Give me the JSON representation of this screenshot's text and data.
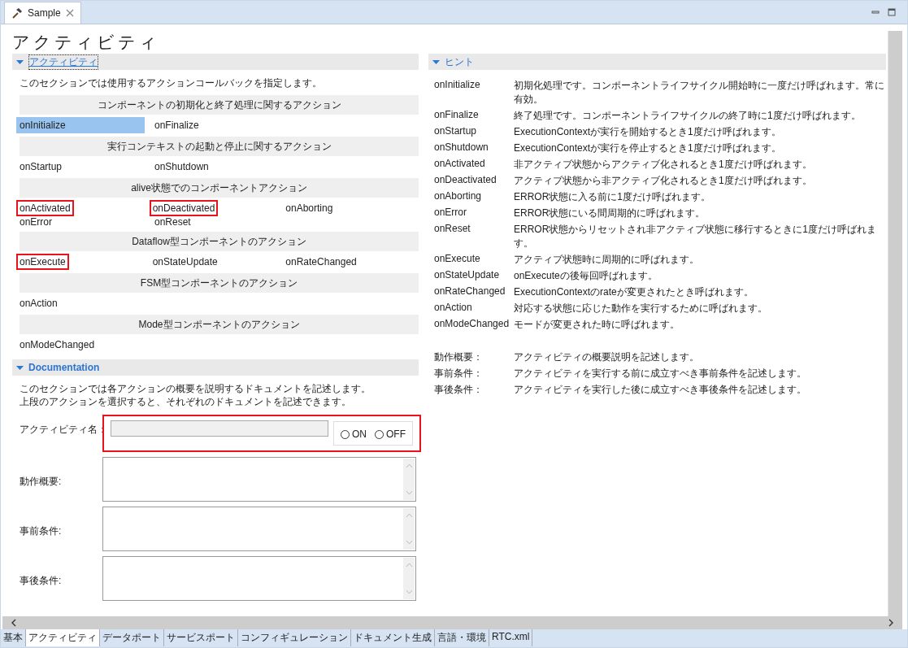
{
  "editor_tab": {
    "title": "Sample",
    "selected": true
  },
  "page_title": "アクティビティ",
  "activity_section": {
    "title": "アクティビティ",
    "expanded": true,
    "description": "このセクションでは使用するアクションコールバックを指定します。",
    "groups": [
      {
        "header": "コンポーネントの初期化と終了処理に関するアクション",
        "rows": [
          [
            {
              "name": "onInitialize",
              "selected": true,
              "highlighted": false
            },
            {
              "name": "onFinalize",
              "selected": false,
              "highlighted": false
            }
          ]
        ]
      },
      {
        "header": "実行コンテキストの起動と停止に関するアクション",
        "rows": [
          [
            {
              "name": "onStartup",
              "selected": false,
              "highlighted": false
            },
            {
              "name": "onShutdown",
              "selected": false,
              "highlighted": false
            }
          ]
        ]
      },
      {
        "header": "alive状態でのコンポーネントアクション",
        "rows": [
          [
            {
              "name": "onActivated",
              "selected": false,
              "highlighted": true
            },
            {
              "name": "onDeactivated",
              "selected": false,
              "highlighted": true
            },
            {
              "name": "onAborting",
              "selected": false,
              "highlighted": false
            }
          ],
          [
            {
              "name": "onError",
              "selected": false,
              "highlighted": false
            },
            {
              "name": "onReset",
              "selected": false,
              "highlighted": false
            }
          ]
        ]
      },
      {
        "header": "Dataflow型コンポーネントのアクション",
        "rows": [
          [
            {
              "name": "onExecute",
              "selected": false,
              "highlighted": true
            },
            {
              "name": "onStateUpdate",
              "selected": false,
              "highlighted": false
            },
            {
              "name": "onRateChanged",
              "selected": false,
              "highlighted": false
            }
          ]
        ]
      },
      {
        "header": "FSM型コンポーネントのアクション",
        "rows": [
          [
            {
              "name": "onAction",
              "selected": false,
              "highlighted": false
            }
          ]
        ]
      },
      {
        "header": "Mode型コンポーネントのアクション",
        "rows": [
          [
            {
              "name": "onModeChanged",
              "selected": false,
              "highlighted": false
            }
          ]
        ]
      }
    ]
  },
  "documentation_section": {
    "title": "Documentation",
    "expanded": true,
    "description_lines": [
      "このセクションでは各アクションの概要を説明するドキュメントを記述します。",
      "上段のアクションを選択すると、それぞれのドキュメントを記述できます。"
    ],
    "name_field": {
      "label": "アクティビティ名：",
      "disabled": true,
      "highlighted": true
    },
    "radios": [
      {
        "label": "ON",
        "selected": false
      },
      {
        "label": "OFF",
        "selected": false
      }
    ],
    "text_areas": [
      {
        "label": "動作概要:"
      },
      {
        "label": "事前条件:"
      },
      {
        "label": "事後条件:"
      }
    ]
  },
  "hints_section": {
    "title": "ヒント",
    "expanded": true,
    "items": [
      {
        "term": "onInitialize",
        "text": "初期化処理です。コンポーネントライフサイクル開始時に一度だけ呼ばれます。常に有効。"
      },
      {
        "term": "onFinalize",
        "text": "終了処理です。コンポーネントライフサイクルの終了時に1度だけ呼ばれます。"
      },
      {
        "term": "onStartup",
        "text": "ExecutionContextが実行を開始するとき1度だけ呼ばれます。"
      },
      {
        "term": "onShutdown",
        "text": "ExecutionContextが実行を停止するとき1度だけ呼ばれます。"
      },
      {
        "term": "onActivated",
        "text": "非アクティブ状態からアクティブ化されるとき1度だけ呼ばれます。"
      },
      {
        "term": "onDeactivated",
        "text": "アクティブ状態から非アクティブ化されるとき1度だけ呼ばれます。"
      },
      {
        "term": "onAborting",
        "text": "ERROR状態に入る前に1度だけ呼ばれます。"
      },
      {
        "term": "onError",
        "text": "ERROR状態にいる間周期的に呼ばれます。"
      },
      {
        "term": "onReset",
        "text": "ERROR状態からリセットされ非アクティブ状態に移行するときに1度だけ呼ばれます。"
      },
      {
        "term": "onExecute",
        "text": "アクティブ状態時に周期的に呼ばれます。"
      },
      {
        "term": "onStateUpdate",
        "text": "onExecuteの後毎回呼ばれます。"
      },
      {
        "term": "onRateChanged",
        "text": "ExecutionContextのrateが変更されたとき呼ばれます。"
      },
      {
        "term": "onAction",
        "text": "対応する状態に応じた動作を実行するために呼ばれます。"
      },
      {
        "term": "onModeChanged",
        "text": "モードが変更された時に呼ばれます。"
      }
    ],
    "doc_items": [
      {
        "term": "動作概要：",
        "text": "アクティビティの概要説明を記述します。"
      },
      {
        "term": "事前条件：",
        "text": "アクティビティを実行する前に成立すべき事前条件を記述します。"
      },
      {
        "term": "事後条件：",
        "text": "アクティビティを実行した後に成立すべき事後条件を記述します。"
      }
    ]
  },
  "bottom_tabs": [
    {
      "label": "基本",
      "selected": false
    },
    {
      "label": "アクティビティ",
      "selected": true
    },
    {
      "label": "データポート",
      "selected": false
    },
    {
      "label": "サービスポート",
      "selected": false
    },
    {
      "label": "コンフィギュレーション",
      "selected": false
    },
    {
      "label": "ドキュメント生成",
      "selected": false
    },
    {
      "label": "言語・環境",
      "selected": false
    },
    {
      "label": "RTC.xml",
      "selected": false
    }
  ]
}
